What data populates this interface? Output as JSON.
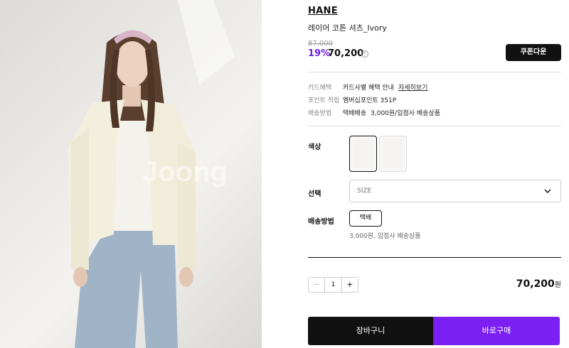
{
  "product": {
    "brand": "HANE",
    "name": "레이어 코튼 셔츠_Ivory",
    "original_price": "87,000",
    "discount": "19%",
    "price": "70,200",
    "info_icon": "question-circle-icon"
  },
  "coupon_label": "쿠폰다운",
  "info": {
    "card_label": "카드혜택",
    "card_value": "카드사별 혜택 안내",
    "card_link": "자세히보기",
    "point_label": "포인트 적립",
    "point_value": "멤버십포인트 351P",
    "ship_label": "배송방법",
    "ship_value": "택배배송",
    "ship_detail": "3,000원/입점사 배송상품"
  },
  "options": {
    "color_label": "색상",
    "size_label": "선택",
    "size_placeholder": "SIZE",
    "shipping_label": "배송방법",
    "shipping_option": "택배",
    "shipping_note": "3,000원, 입점사 배송상품"
  },
  "order": {
    "quantity": "1",
    "minus": "−",
    "plus": "+",
    "total": "70,200",
    "total_unit": "원"
  },
  "buttons": {
    "cart": "장바구니",
    "buy": "바로구매"
  },
  "photo": {
    "watermark": "Joong"
  },
  "colors": {
    "accent": "#7b1ff2",
    "discount": "#6b1fe0",
    "dark": "#111111"
  }
}
